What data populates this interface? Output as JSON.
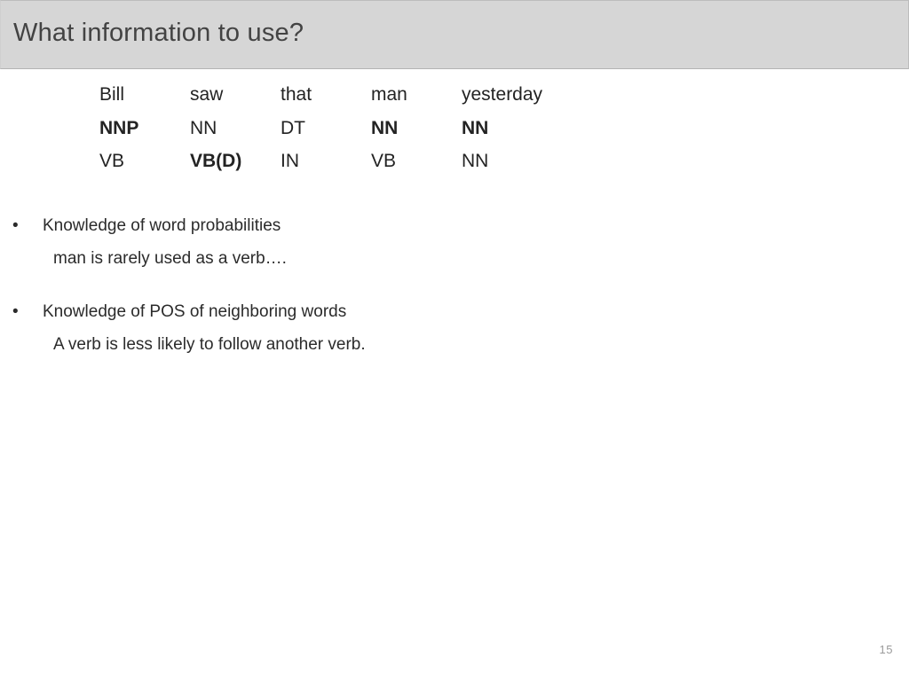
{
  "header": {
    "title": "What information to use?",
    "background_color": "#d6d6d6",
    "text_color": "#434343"
  },
  "pos_table": {
    "rows": [
      {
        "name": "words",
        "cells": [
          {
            "text": "Bill",
            "bold": false
          },
          {
            "text": "saw",
            "bold": false
          },
          {
            "text": "that",
            "bold": false
          },
          {
            "text": "man",
            "bold": false
          },
          {
            "text": "yesterday",
            "bold": false
          }
        ]
      },
      {
        "name": "tags-primary",
        "cells": [
          {
            "text": "NNP",
            "bold": true
          },
          {
            "text": "NN",
            "bold": false
          },
          {
            "text": "DT",
            "bold": false
          },
          {
            "text": "NN",
            "bold": true
          },
          {
            "text": "NN",
            "bold": true
          }
        ]
      },
      {
        "name": "tags-alternate",
        "cells": [
          {
            "text": "VB",
            "bold": false
          },
          {
            "text": "VB(D)",
            "bold": true
          },
          {
            "text": "IN",
            "bold": false
          },
          {
            "text": "VB",
            "bold": false
          },
          {
            "text": "NN",
            "bold": false
          }
        ]
      }
    ]
  },
  "bullets": {
    "marker": "•",
    "items": [
      {
        "heading": "Knowledge of word probabilities",
        "detail": "man is rarely used as a verb…."
      },
      {
        "heading": "Knowledge of POS of neighboring words",
        "detail": "A verb is less likely to follow another verb."
      }
    ]
  },
  "footer": {
    "page_number": "15"
  }
}
